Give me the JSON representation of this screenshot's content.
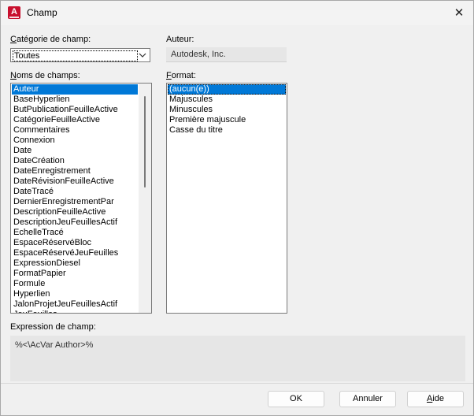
{
  "window": {
    "title": "Champ",
    "app_icon_letter": "A",
    "close_symbol": "✕"
  },
  "category": {
    "label_prefix": "C",
    "label_rest": "atégorie de champ:",
    "selected": "Toutes"
  },
  "author": {
    "label": "Auteur:",
    "value": "Autodesk, Inc."
  },
  "field_names": {
    "label_prefix": "N",
    "label_rest": "oms de champs:",
    "selected_index": 0,
    "items": [
      "Auteur",
      "BaseHyperlien",
      "ButPublicationFeuilleActive",
      "CatégorieFeuilleActive",
      "Commentaires",
      "Connexion",
      "Date",
      "DateCréation",
      "DateEnregistrement",
      "DateRévisionFeuilleActive",
      "DateTracé",
      "DernierEnregistrementPar",
      "DescriptionFeuilleActive",
      "DescriptionJeuFeuillesActif",
      "EchelleTracé",
      "EspaceRéservéBloc",
      "EspaceRéservéJeuFeuilles",
      "ExpressionDiesel",
      "FormatPapier",
      "Formule",
      "Hyperlien",
      "JalonProjetJeuFeuillesActif",
      "JeuFeuilles"
    ]
  },
  "format": {
    "label_prefix": "F",
    "label_rest": "ormat:",
    "selected_index": 0,
    "items": [
      "(aucun(e))",
      "Majuscules",
      "Minuscules",
      "Première majuscule",
      "Casse du titre"
    ]
  },
  "expression": {
    "label": "Expression de champ:",
    "value": "%<\\AcVar Author>%"
  },
  "buttons": {
    "ok": "OK",
    "cancel": "Annuler",
    "help_prefix": "A",
    "help_rest": "ide"
  },
  "colors": {
    "selection": "#0078d7",
    "app_icon": "#c8102e"
  }
}
